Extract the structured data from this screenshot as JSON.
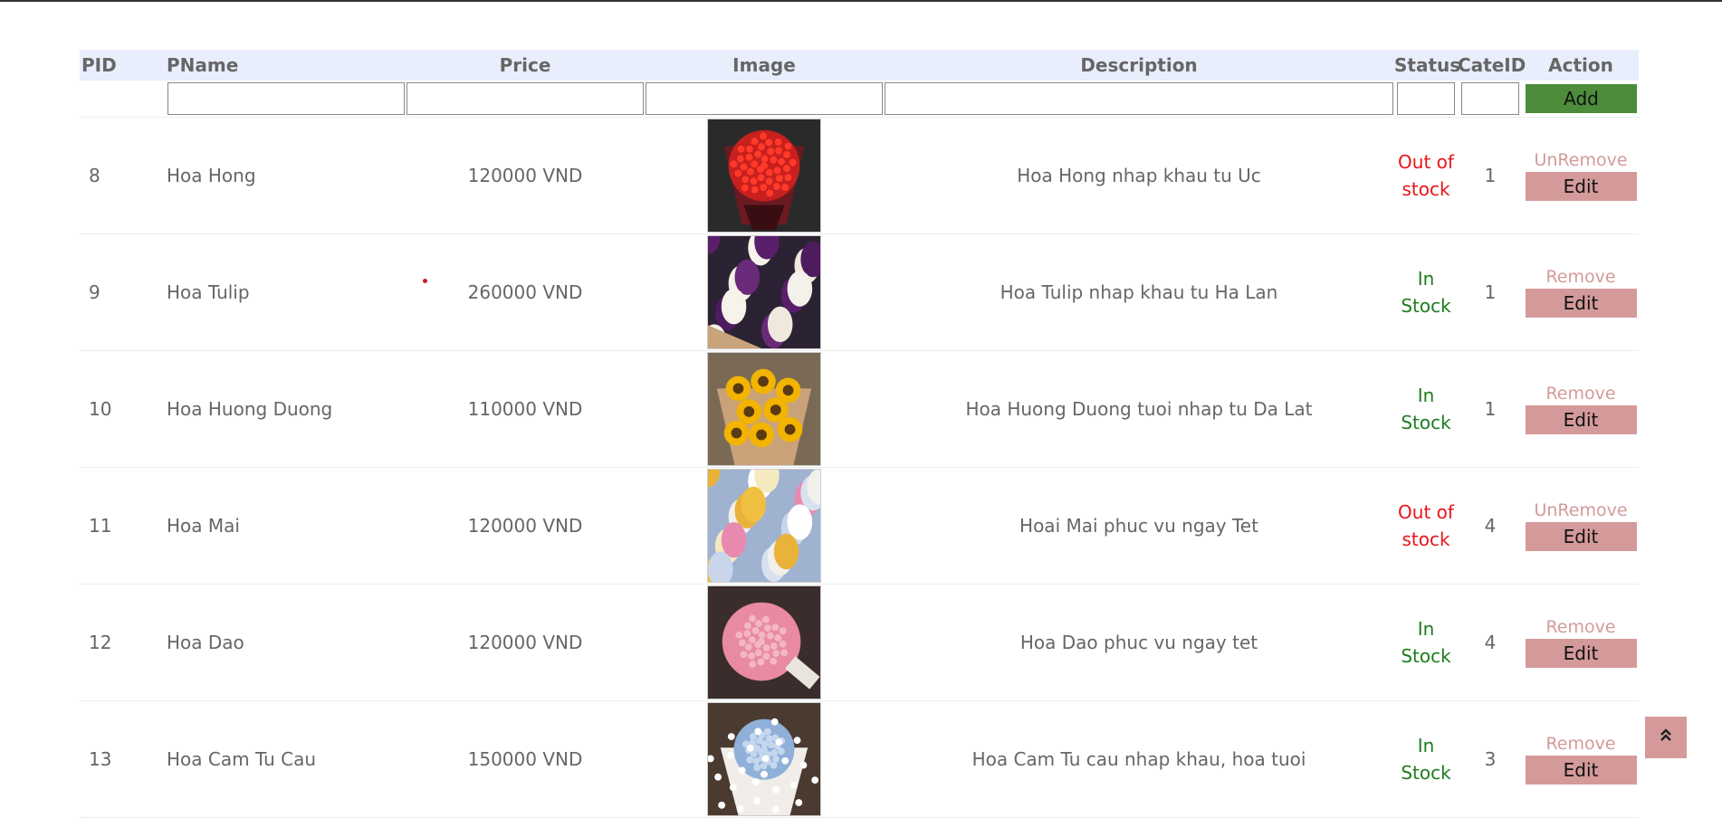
{
  "header": {
    "pid": "PID",
    "pname": "PName",
    "price": "Price",
    "image": "Image",
    "description": "Description",
    "status": "Status",
    "cateid": "CateID",
    "action": "Action"
  },
  "filters": {
    "add_label": "Add"
  },
  "products": [
    {
      "pid": "8",
      "name": "Hoa Hong",
      "price": "120000 VND",
      "image_icon": "red-rose-bouquet-image",
      "description": "Hoa Hong nhap khau tu Uc",
      "status": [
        "Out of",
        "stock"
      ],
      "status_type": "out",
      "cateid": "1",
      "remove_label": "UnRemove",
      "edit_label": "Edit"
    },
    {
      "pid": "9",
      "name": "Hoa Tulip",
      "price": "260000 VND",
      "image_icon": "tulip-bouquet-image",
      "description": "Hoa Tulip nhap khau tu Ha Lan",
      "status": [
        "In",
        "Stock"
      ],
      "status_type": "in",
      "cateid": "1",
      "remove_label": "Remove",
      "edit_label": "Edit"
    },
    {
      "pid": "10",
      "name": "Hoa Huong Duong",
      "price": "110000 VND",
      "image_icon": "sunflower-bouquet-image",
      "description": "Hoa Huong Duong tuoi nhap tu Da Lat",
      "status": [
        "In",
        "Stock"
      ],
      "status_type": "in",
      "cateid": "1",
      "remove_label": "Remove",
      "edit_label": "Edit"
    },
    {
      "pid": "11",
      "name": "Hoa Mai",
      "price": "120000 VND",
      "image_icon": "mixed-flower-bouquet-image",
      "description": "Hoai Mai phuc vu ngay Tet",
      "status": [
        "Out of",
        "stock"
      ],
      "status_type": "out",
      "cateid": "4",
      "remove_label": "UnRemove",
      "edit_label": "Edit"
    },
    {
      "pid": "12",
      "name": "Hoa Dao",
      "price": "120000 VND",
      "image_icon": "pink-peony-bouquet-image",
      "description": "Hoa Dao phuc vu ngay tet",
      "status": [
        "In",
        "Stock"
      ],
      "status_type": "in",
      "cateid": "4",
      "remove_label": "Remove",
      "edit_label": "Edit"
    },
    {
      "pid": "13",
      "name": "Hoa Cam Tu Cau",
      "price": "150000 VND",
      "image_icon": "hydrangea-bouquet-image",
      "description": "Hoa Cam Tu cau nhap khau, hoa tuoi",
      "status": [
        "In",
        "Stock"
      ],
      "status_type": "in",
      "cateid": "3",
      "remove_label": "Remove",
      "edit_label": "Edit"
    }
  ],
  "scroll_top_icon": "double-chevron-up-icon",
  "colors": {
    "header_bg": "#e9eefc",
    "add_button": "#4c8c3a",
    "edit_button": "#d49a9a",
    "status_out": "#e8141a",
    "status_in": "#1c7c1c"
  }
}
